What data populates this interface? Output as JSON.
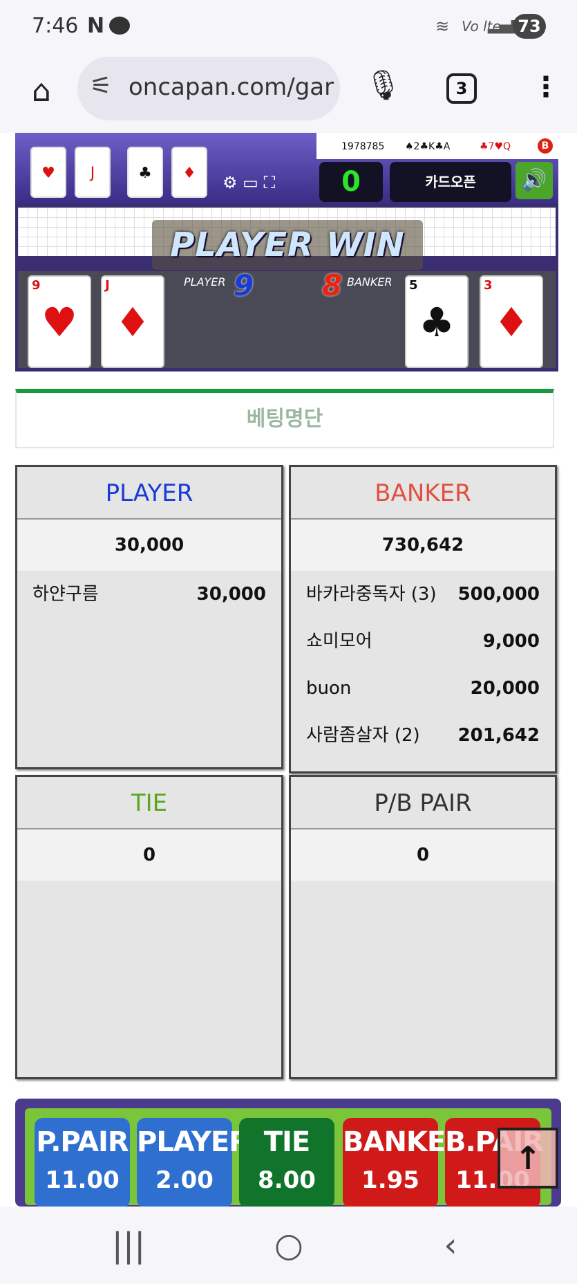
{
  "status_bar": {
    "time": "7:46",
    "notif_n": "N",
    "battery": "73",
    "volte": "Vo lte"
  },
  "browser": {
    "url": "oncapan.com/gar",
    "tab_count": "3"
  },
  "game": {
    "round_id": "1978785",
    "result_player": "♠2♣K♣A",
    "result_banker": "♣7♥Q",
    "result_badge": "B",
    "counter": "0",
    "card_open_label": "카드오픈",
    "win_banner": "PLAYER WIN",
    "player_label": "PLAYER",
    "player_score": "9",
    "banker_label": "BANKER",
    "banker_score": "8",
    "player_cards": [
      {
        "rank": "9",
        "suit": "♥",
        "color": "#d11"
      },
      {
        "rank": "J",
        "suit": "♦",
        "color": "#d11"
      }
    ],
    "banker_cards": [
      {
        "rank": "5",
        "suit": "♣",
        "color": "#111"
      },
      {
        "rank": "3",
        "suit": "♦",
        "color": "#d11"
      }
    ]
  },
  "bet_list_title": "베팅명단",
  "panels": {
    "player": {
      "title": "PLAYER",
      "title_color": "#1a3bd8",
      "total": "30,000",
      "rows": [
        {
          "name": "하얀구름",
          "amount": "30,000"
        }
      ]
    },
    "banker": {
      "title": "BANKER",
      "title_color": "#e05040",
      "total": "730,642",
      "rows": [
        {
          "name": "바카라중독자 (3)",
          "amount": "500,000"
        },
        {
          "name": "쇼미모어",
          "amount": "9,000"
        },
        {
          "name": "buon",
          "amount": "20,000"
        },
        {
          "name": "사람좀살자 (2)",
          "amount": "201,642"
        }
      ]
    },
    "tie": {
      "title": "TIE",
      "title_color": "#5aa820",
      "total": "0"
    },
    "pair": {
      "title": "P/B PAIR",
      "title_color": "#333333",
      "total": "0"
    }
  },
  "bet_buttons": [
    {
      "label": "P.PAIR",
      "odds": "11.00",
      "color": "#2f6fd0"
    },
    {
      "label": "PLAYER",
      "odds": "2.00",
      "color": "#2f6fd0"
    },
    {
      "label": "TIE",
      "odds": "8.00",
      "color": "#10742a"
    },
    {
      "label": "BANKER",
      "odds": "1.95",
      "color": "#d01a1a"
    },
    {
      "label": "B.PAIR",
      "odds": "11.00",
      "color": "#d01a1a"
    }
  ]
}
